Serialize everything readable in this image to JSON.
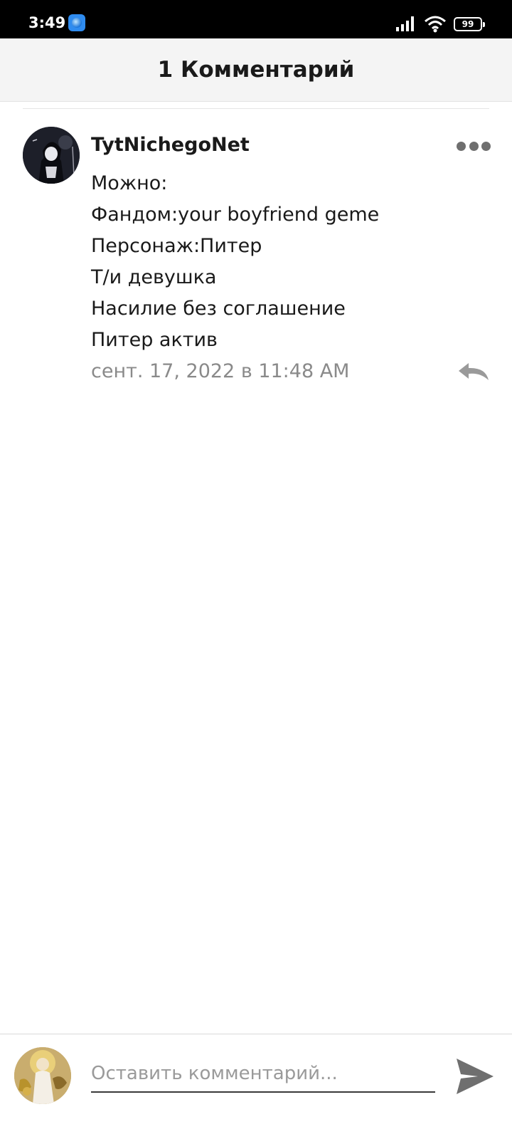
{
  "status_bar": {
    "time": "3:49",
    "battery": "99",
    "icons": [
      "browser-app-icon",
      "signal-icon",
      "wifi-icon",
      "battery-icon"
    ]
  },
  "header": {
    "title": "1 Комментарий"
  },
  "comment": {
    "author": "TytNichegoNet",
    "lines": [
      "Можно:",
      "Фандом:your boyfriend geme",
      "Персонаж:Питер",
      "Т/и девушка",
      "Насилие без соглашение",
      "Питер актив"
    ],
    "timestamp": "сент. 17, 2022 в 11:48 AM",
    "icons": [
      "more-options-icon",
      "reply-icon"
    ]
  },
  "composer": {
    "placeholder": "Оставить комментарий...",
    "value": "",
    "icons": [
      "send-icon"
    ]
  },
  "colors": {
    "status_bar_bg": "#000000",
    "header_bg": "#f4f4f4",
    "text_primary": "#1a1a1a",
    "text_secondary": "#8a8a8a",
    "icon_gray": "#6f6f6f"
  }
}
